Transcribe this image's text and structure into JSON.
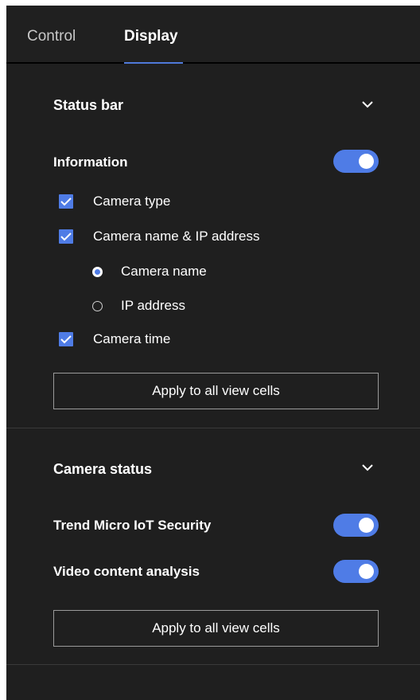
{
  "tabs": {
    "control_label": "Control",
    "display_label": "Display",
    "active": "Display"
  },
  "status_bar": {
    "title": "Status bar",
    "information": {
      "label": "Information",
      "enabled": true
    },
    "options": [
      {
        "label": "Camera type",
        "checked": true
      },
      {
        "label": "Camera name & IP address",
        "checked": true
      },
      {
        "label": "Camera time",
        "checked": true
      }
    ],
    "name_mode": [
      {
        "label": "Camera name",
        "selected": true
      },
      {
        "label": "IP address",
        "selected": false
      }
    ],
    "apply_label": "Apply to all view cells"
  },
  "camera_status": {
    "title": "Camera status",
    "items": [
      {
        "label": "Trend Micro IoT Security",
        "enabled": true
      },
      {
        "label": "Video content analysis",
        "enabled": true
      }
    ],
    "apply_label": "Apply to all view cells"
  },
  "colors": {
    "background": "#1f1f1f",
    "accent": "#4f7ce6",
    "divider": "#3a3a3a"
  }
}
